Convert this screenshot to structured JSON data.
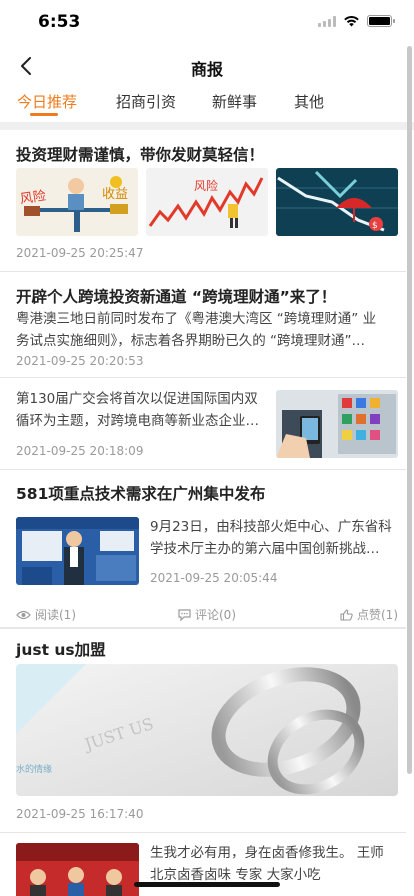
{
  "status_bar": {
    "time": "6:53"
  },
  "nav": {
    "title": "商报"
  },
  "tabs": [
    {
      "label": "今日推荐",
      "active": true
    },
    {
      "label": "招商引资",
      "active": false
    },
    {
      "label": "新鲜事",
      "active": false
    },
    {
      "label": "其他",
      "active": false
    }
  ],
  "colors": {
    "accent": "#f07b1c",
    "band": "#efefef"
  },
  "articles": [
    {
      "title": "投资理财需谨慎，带你发财莫轻信！",
      "images": [
        "风险 收益 天平 漫画",
        "风险 折线图",
        "下跌 伞 图表"
      ],
      "date": "2021-09-25 20:25:47"
    },
    {
      "title": "开辟个人跨境投资新通道 “跨境理财通”来了！",
      "summary_line1": "粤港澳三地日前同时发布了《粤港澳大湾区 “跨境理财通” 业",
      "summary_line2": "务试点实施细则》，标志着各界期盼已久的 “跨境理财通”…",
      "date": "2021-09-25 20:20:53"
    },
    {
      "summary_line1": "第130届广交会将首次以促进国际国内双",
      "summary_line2": "循环为主题，对跨境电商等新业态企业…",
      "date": "2021-09-25 20:18:09"
    },
    {
      "title": "581项重点技术需求在广州集中发布",
      "summary_line1": "9月23日，由科技部火炬中心、广东省科",
      "summary_line2": "学技术厅主办的第六届中国创新挑战…",
      "date": "2021-09-25 20:05:44",
      "stats": {
        "reads": "阅读(1)",
        "comments": "评论(0)",
        "likes": "点赞(1)"
      }
    },
    {
      "title": "just us加盟",
      "date": "2021-09-25 16:17:40"
    },
    {
      "summary_line1": "生我才必有用，身在卤香修我生。 王师",
      "summary_line2": "北京卤香卤味 专家 大家小吃"
    }
  ],
  "icons": [
    "back-arrow-icon",
    "eye-icon",
    "comment-icon",
    "thumbs-up-icon",
    "wifi-icon",
    "signal-icon",
    "battery-icon"
  ]
}
